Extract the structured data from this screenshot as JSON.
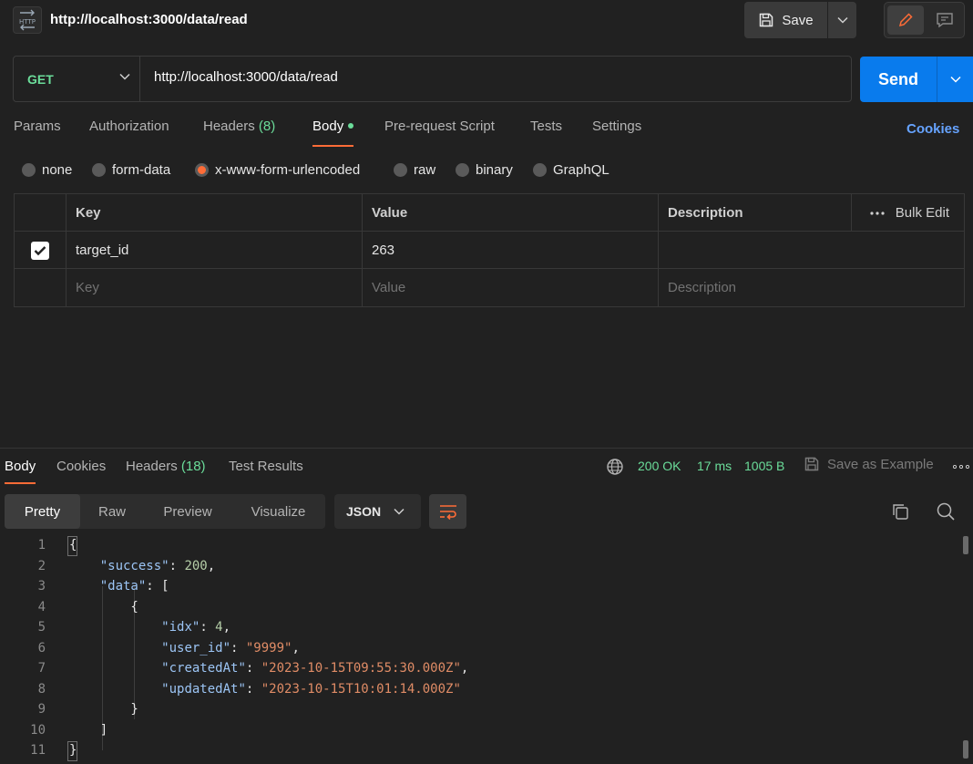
{
  "titlebar": {
    "icon": "http-icon",
    "title": "http://localhost:3000/data/read",
    "save_label": "Save"
  },
  "request": {
    "method": "GET",
    "url": "http://localhost:3000/data/read",
    "send_label": "Send"
  },
  "request_tabs": [
    {
      "label": "Params"
    },
    {
      "label": "Authorization"
    },
    {
      "label": "Headers",
      "count": "(8)"
    },
    {
      "label": "Body",
      "active": true
    },
    {
      "label": "Pre-request Script"
    },
    {
      "label": "Tests"
    },
    {
      "label": "Settings"
    }
  ],
  "cookies_label": "Cookies",
  "body_types": [
    {
      "label": "none"
    },
    {
      "label": "form-data"
    },
    {
      "label": "x-www-form-urlencoded",
      "selected": true
    },
    {
      "label": "raw"
    },
    {
      "label": "binary"
    },
    {
      "label": "GraphQL"
    }
  ],
  "params_table": {
    "headers": {
      "key": "Key",
      "value": "Value",
      "description": "Description",
      "bulk_edit": "Bulk Edit"
    },
    "rows": [
      {
        "checked": true,
        "key": "target_id",
        "value": "263",
        "description": ""
      }
    ],
    "placeholder": {
      "key": "Key",
      "value": "Value",
      "description": "Description"
    }
  },
  "response": {
    "tabs": [
      {
        "label": "Body",
        "active": true
      },
      {
        "label": "Cookies"
      },
      {
        "label": "Headers",
        "count": "(18)"
      },
      {
        "label": "Test Results"
      }
    ],
    "status": "200 OK",
    "time": "17 ms",
    "size": "1005 B",
    "save_example_label": "Save as Example",
    "views": [
      "Pretty",
      "Raw",
      "Preview",
      "Visualize"
    ],
    "format": "JSON",
    "line_numbers": [
      "1",
      "2",
      "3",
      "4",
      "5",
      "6",
      "7",
      "8",
      "9",
      "10",
      "11"
    ],
    "json": {
      "success": 200,
      "idx": 4,
      "user_id": "\"9999\"",
      "createdAt": "\"2023-10-15T09:55:30.000Z\"",
      "updatedAt": "\"2023-10-15T10:01:14.000Z\""
    },
    "keys": {
      "success": "\"success\"",
      "data": "\"data\"",
      "idx": "\"idx\"",
      "user_id": "\"user_id\"",
      "createdAt": "\"createdAt\"",
      "updatedAt": "\"updatedAt\""
    }
  },
  "colors": {
    "accent": "#ff6c37",
    "send": "#097bed",
    "success": "#6bdd9a",
    "link": "#66a3ff"
  }
}
